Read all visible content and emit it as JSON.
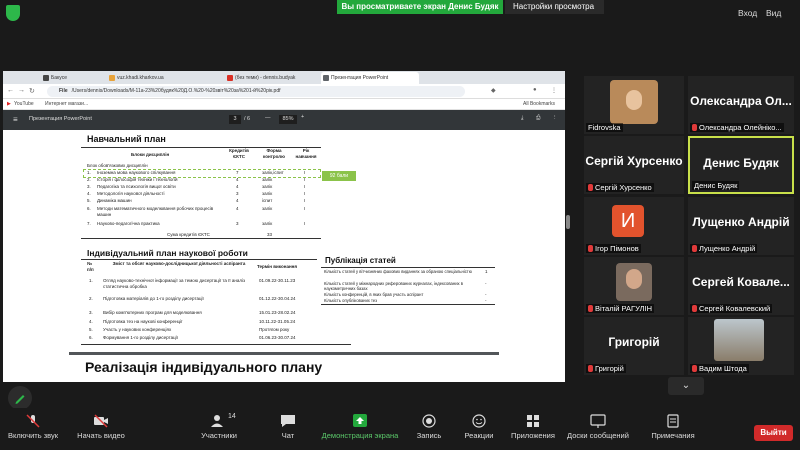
{
  "topbar": {
    "share_banner": "Вы просматриваете экран Денис Будяк",
    "view_settings": "Настройки просмотра",
    "login": "Вход",
    "view": "Вид"
  },
  "browser": {
    "tabs": [
      "Бакусе",
      "vuz.khadi.kharkov.ua",
      "(без теми) - dennis.budyak",
      "Презентация PowerPoint"
    ],
    "address_label": "File",
    "address": "/Users/dennis/Downloads/M-11a-23%20будяк%20Д.О.%20-%20звіт%20за%201-й%20рік.pdf",
    "bookmarks": [
      "YouTube",
      "Интернет магази..."
    ],
    "all_bookmarks": "All Bookmarks"
  },
  "pdf": {
    "title": "Презентация PowerPoint",
    "page_current": "3",
    "page_total": "/ 6",
    "zoom": "85%",
    "badge": "92 бали",
    "plan": {
      "heading": "Навчальний план",
      "col_blocks": "Блоки дисциплін",
      "col_credits": "Кредитів ЄКТС",
      "col_form": "Форма контролю",
      "col_year": "Рік навчання",
      "section": "Блок обов'язкових дисциплін",
      "rows": [
        {
          "n": "1.",
          "name": "Іноземна мова наукового спілкування",
          "credits": "7",
          "form": "залік,іспит",
          "year": "І"
        },
        {
          "n": "2.",
          "name": "Історія і філософія техніки і технологій",
          "credits": "4",
          "form": "залік",
          "year": "І"
        },
        {
          "n": "3.",
          "name": "Педагогіка та психологія вищої освіти",
          "credits": "4",
          "form": "залік",
          "year": "І"
        },
        {
          "n": "4.",
          "name": "Методологія наукової діяльності",
          "credits": "3",
          "form": "залік",
          "year": "І"
        },
        {
          "n": "5.",
          "name": "Динаміка машин",
          "credits": "4",
          "form": "іспит",
          "year": "І"
        },
        {
          "n": "6.",
          "name": "Методи математичного моделювання робочих процесів машин",
          "credits": "4",
          "form": "залік",
          "year": "І"
        },
        {
          "n": "7.",
          "name": "Науково-педагогічна практика",
          "credits": "3",
          "form": "залік",
          "year": "І"
        }
      ],
      "sum_label": "Сума кредитів ЄКТС",
      "sum_value": "33"
    },
    "individual": {
      "heading": "Індивідуальний план наукової роботи",
      "col_n": "№ п/п",
      "col_content": "Зміст та обсяг науково-дослідницької діяльності аспіранта",
      "col_term": "Термін виконання",
      "rows": [
        {
          "n": "1.",
          "text": "Огляд науково-технічної інформації за темою дисертації та її аналіз статистична обробка",
          "term": "01.09.22-30.11.23"
        },
        {
          "n": "2.",
          "text": "Підготовка матеріалів до 1-го розділу дисертації",
          "term": "01.12.22-30.04.24"
        },
        {
          "n": "3.",
          "text": "Вибір комп'ютерних програм для моделювання",
          "term": "15.01.23-28.02.24"
        },
        {
          "n": "4.",
          "text": "Підготовка тез на наукові конференції",
          "term": "10.11.22-31.05.24"
        },
        {
          "n": "5.",
          "text": "Участь у наукових конференціях",
          "term": "Протягом року"
        },
        {
          "n": "6.",
          "text": "Формування 1-го розділу дисертації",
          "term": "01.06.23-30.07.24"
        }
      ]
    },
    "publications": {
      "heading": "Публікація статей",
      "rows": [
        {
          "text": "Кількість статей у вітчизняних фахових виданнях за обраною спеціальністю",
          "value": "1"
        },
        {
          "text": "Кількість статей у міжнародних реферованих журналах, індексованих в наукометричних базах",
          "value": "-"
        },
        {
          "text": "Кількість конференцій, в яких брав участь аспірант",
          "value": "-"
        },
        {
          "text": "Кількість опублікованих тез",
          "value": "-"
        }
      ]
    },
    "next_heading": "Реалізація індивідуального плану"
  },
  "participants": [
    {
      "name": "",
      "label": "Fidrovska",
      "muted": false
    },
    {
      "name": "Олександра Ол...",
      "label": "Олександра Олейніко...",
      "muted": true
    },
    {
      "name": "Сергій Хурсенко",
      "label": "Сергій Хурсенко",
      "muted": true
    },
    {
      "name": "Денис Будяк",
      "label": "Денис Будяк",
      "muted": false
    },
    {
      "name": "И",
      "label": "Ігор Пімонов",
      "muted": true
    },
    {
      "name": "Лущенко Андрій",
      "label": "Лущенко Андрій",
      "muted": true
    },
    {
      "name": "",
      "label": "Віталій РАГУЛІН",
      "muted": true
    },
    {
      "name": "Сергей Ковале...",
      "label": "Сергей Ковалевский",
      "muted": true
    },
    {
      "name": "Григорій",
      "label": "Григорій",
      "muted": true
    },
    {
      "name": "",
      "label": "Вадим Штода",
      "muted": true
    }
  ],
  "toolbar": {
    "mic": "Включить звук",
    "video": "Начать видео",
    "participants": "Участники",
    "participants_count": "14",
    "chat": "Чат",
    "share": "Демонстрация экрана",
    "record": "Запись",
    "reactions": "Реакции",
    "apps": "Приложения",
    "whiteboards": "Доски сообщений",
    "notes": "Примечания",
    "exit": "Выйти"
  },
  "colors": {
    "accent_green": "#23a83c",
    "exit_red": "#d12a2a",
    "active_speaker": "#c8e04a"
  }
}
